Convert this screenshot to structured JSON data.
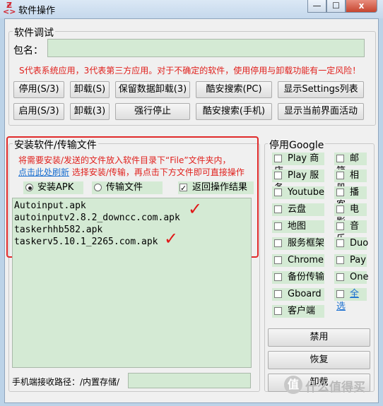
{
  "window": {
    "title": "软件操作",
    "app_icon": "z-app-icon",
    "min_glyph": "—",
    "max_glyph": "☐",
    "close_glyph": "x"
  },
  "debug": {
    "group_label": "软件调试",
    "package_label": "包名：",
    "package_value": "",
    "warning": "S代表系统应用，3代表第三方应用。对于不确定的软件，使用停用与卸载功能有一定风险！",
    "row1": [
      "停用(S/3)",
      "卸载(S)",
      "保留数据卸载(3)",
      "酷安搜索(PC)",
      "显示Settings列表"
    ],
    "row2": [
      "启用(S/3)",
      "卸载(3)",
      "强行停止",
      "酷安搜索(手机)",
      "显示当前界面活动"
    ]
  },
  "install": {
    "group_label": "安装软件/传输文件",
    "hint1": "将需要安装/发送的文件放入软件目录下“File”文件夹内，",
    "refresh_link": "点击此处刷新",
    "hint2": " 选择安装/传输，再点击下方文件即可直接操作",
    "radio_apk": "安装APK",
    "radio_file": "传输文件",
    "return_result": "返回操作结果",
    "files": [
      "Autoinput.apk",
      "autoinputv2.8.2_downcc.com.apk",
      "taskerhhb582.apk",
      "taskerv5.10.1_2265.com.apk"
    ],
    "receive_path_label": "手机端接收路径：/内置存储/",
    "receive_path_value": "",
    "check_glyph": "✓"
  },
  "google": {
    "group_label": "停用Google",
    "left": [
      "Play 商店",
      "Play 服务",
      "Youtube",
      "云盘",
      "地图",
      "服务框架",
      "Chrome",
      "备份传输",
      "Gboard",
      "客户端"
    ],
    "right": [
      "邮箱",
      "相册",
      "播客",
      "电影",
      "音乐",
      "Duo",
      "Pay",
      "One"
    ],
    "select_all": "全选",
    "disable_btn": "禁用",
    "restore_btn": "恢复",
    "uninstall_btn": "卸载"
  },
  "watermark": {
    "badge": "值",
    "text": "什么值得买"
  }
}
